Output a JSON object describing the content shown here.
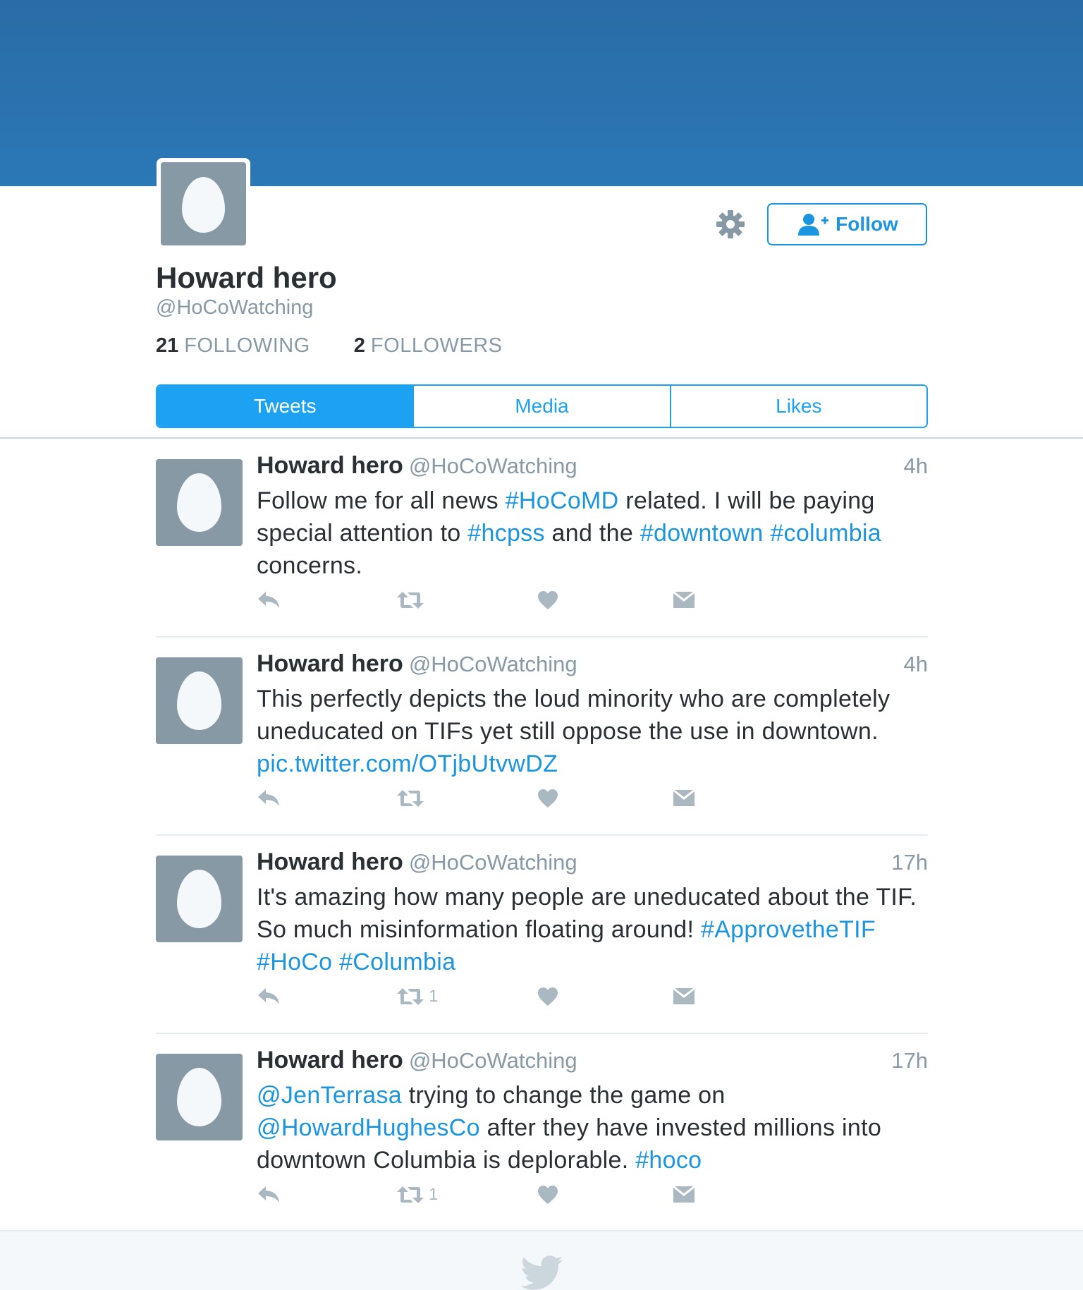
{
  "profile": {
    "name": "Howard hero",
    "handle": "@HoCoWatching",
    "following_count": "21",
    "following_label": "FOLLOWING",
    "followers_count": "2",
    "followers_label": "FOLLOWERS",
    "avatar_icon": "default-egg-avatar"
  },
  "actions": {
    "settings_icon": "gear-icon",
    "follow_label": "Follow",
    "follow_icon": "add-user-icon"
  },
  "tabs": [
    {
      "label": "Tweets",
      "active": true
    },
    {
      "label": "Media",
      "active": false
    },
    {
      "label": "Likes",
      "active": false
    }
  ],
  "colors": {
    "banner": "#2b72ae",
    "accent": "#1da1f2",
    "text": "#292f33",
    "muted": "#8899a6",
    "icon": "#aab8c2"
  },
  "tweets": [
    {
      "name": "Howard hero",
      "handle": "@HoCoWatching",
      "time": "4h",
      "segments": [
        {
          "t": "Follow me for all news "
        },
        {
          "t": "#HoCoMD",
          "link": true
        },
        {
          "t": "  related. I will be paying special attention to "
        },
        {
          "t": "#hcpss",
          "link": true
        },
        {
          "t": " and the "
        },
        {
          "t": "#downtown",
          "link": true
        },
        {
          "t": " "
        },
        {
          "t": "#columbia",
          "link": true
        },
        {
          "t": " concerns."
        }
      ],
      "retweet_count": ""
    },
    {
      "name": "Howard hero",
      "handle": "@HoCoWatching",
      "time": "4h",
      "segments": [
        {
          "t": "This perfectly depicts the loud minority who are completely uneducated on TIFs yet still oppose the use in downtown. "
        },
        {
          "t": "pic.twitter.com/OTjbUtvwDZ",
          "link": true
        }
      ],
      "retweet_count": ""
    },
    {
      "name": "Howard hero",
      "handle": "@HoCoWatching",
      "time": "17h",
      "segments": [
        {
          "t": "It's amazing how many people are uneducated about the TIF. So much misinformation floating around! "
        },
        {
          "t": "#ApprovetheTIF",
          "link": true
        },
        {
          "t": " "
        },
        {
          "t": "#HoCo",
          "link": true
        },
        {
          "t": " "
        },
        {
          "t": "#Columbia",
          "link": true
        }
      ],
      "retweet_count": "1"
    },
    {
      "name": "Howard hero",
      "handle": "@HoCoWatching",
      "time": "17h",
      "segments": [
        {
          "t": "@JenTerrasa",
          "link": true
        },
        {
          "t": " trying to change the game on "
        },
        {
          "t": "@HowardHughesCo",
          "link": true
        },
        {
          "t": " after they have invested millions into downtown Columbia is deplorable. "
        },
        {
          "t": "#hoco",
          "link": true
        }
      ],
      "retweet_count": "1"
    }
  ],
  "footer": {
    "icon": "twitter-bird-icon"
  }
}
